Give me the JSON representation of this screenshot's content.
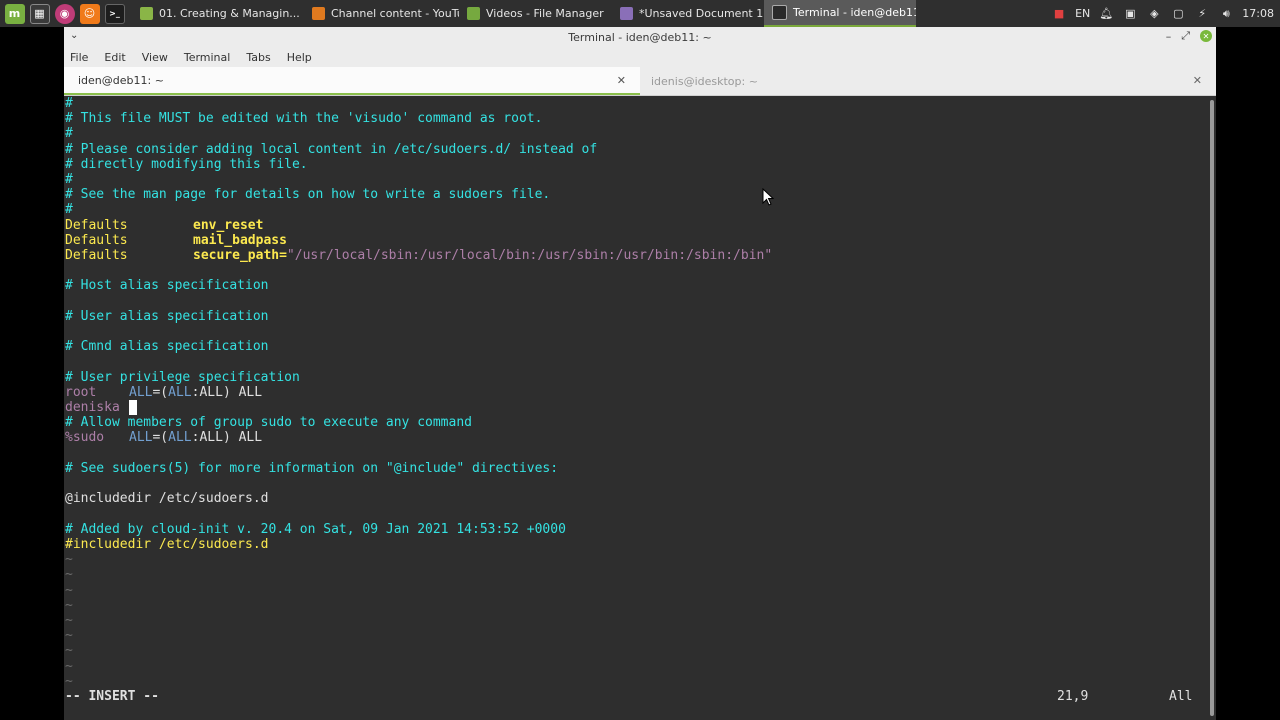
{
  "panel": {
    "launchers": [
      {
        "name": "mint-menu-icon",
        "glyph": "m",
        "color": "#79b041"
      },
      {
        "name": "window-list-icon",
        "glyph": "▦",
        "color": "#3a3a3a"
      },
      {
        "name": "screenshot-app-icon",
        "glyph": "◉",
        "color": "#c03c78"
      },
      {
        "name": "app-launcher-icon",
        "glyph": "☺",
        "color": "#f07a1a"
      },
      {
        "name": "terminal-launcher-icon",
        "glyph": ">_",
        "color": "#1d1d1d"
      }
    ],
    "tasks": [
      {
        "label": "01. Creating & Managin...",
        "icon_color": "#8ab547",
        "active": false
      },
      {
        "label": "Channel content - YouTu...",
        "icon_color": "#e07a1f",
        "active": false
      },
      {
        "label": "Videos - File Manager",
        "icon_color": "#76a93f",
        "active": false
      },
      {
        "label": "*Unsaved Document 1",
        "icon_color": "#8a6fb8",
        "active": false
      },
      {
        "label": "Terminal - iden@deb11: ~",
        "icon_color": "#2a2a2a",
        "active": true
      }
    ],
    "tray": {
      "keyboard_layout": "EN",
      "clock": "17:08"
    }
  },
  "window": {
    "title": "Terminal - iden@deb11: ~",
    "menu": [
      "File",
      "Edit",
      "View",
      "Terminal",
      "Tabs",
      "Help"
    ],
    "tabs": [
      {
        "label": "iden@deb11: ~",
        "active": true
      },
      {
        "label": "idenis@idesktop: ~",
        "active": false
      }
    ]
  },
  "editor": {
    "lines": {
      "l1": "#",
      "l2": "# This file MUST be edited with the 'visudo' command as root.",
      "l3": "#",
      "l4": "# Please consider adding local content in /etc/sudoers.d/ instead of",
      "l5": "# directly modifying this file.",
      "l6": "#",
      "l7": "# See the man page for details on how to write a sudoers file.",
      "l8": "#",
      "d1k": "Defaults",
      "d1v": "env_reset",
      "d2k": "Defaults",
      "d2v": "mail_badpass",
      "d3k": "Defaults",
      "d3v": "secure_path=",
      "d3s": "\"/usr/local/sbin:/usr/local/bin:/usr/sbin:/usr/bin:/sbin:/bin\"",
      "h1": "# Host alias specification",
      "u1": "# User alias specification",
      "c1": "# Cmnd alias specification",
      "p1": "# User privilege specification",
      "r_user": "root",
      "r_all1": "ALL",
      "r_eq": "=(",
      "r_all2": "ALL",
      "r_colon": ":",
      "r_all3": "ALL",
      "r_close": ") ALL",
      "dn_user": "deniska",
      "g1": "# Allow members of group sudo to execute any command",
      "s_user": "%sudo",
      "s_all1": "ALL",
      "s_eq": "=(",
      "s_all2": "ALL",
      "s_colon": ":",
      "s_all3": "ALL",
      "s_close": ") ALL",
      "inc_cmt": "# See sudoers(5) for more information on \"@include\" directives:",
      "inc1": "@includedir /etc/sudoers.d",
      "ci": "# Added by cloud-init v. 20.4 on Sat, 09 Jan 2021 14:53:52 +0000",
      "inc2": "#includedir /etc/sudoers.d",
      "tilde": "~"
    },
    "status": {
      "mode": "-- INSERT --",
      "position": "21,9",
      "scroll": "All"
    }
  },
  "colors": {
    "comment": "#34e2e2",
    "keyword": "#fce94f",
    "string": "#ad7fa8",
    "accent": "#8bbf4b"
  }
}
